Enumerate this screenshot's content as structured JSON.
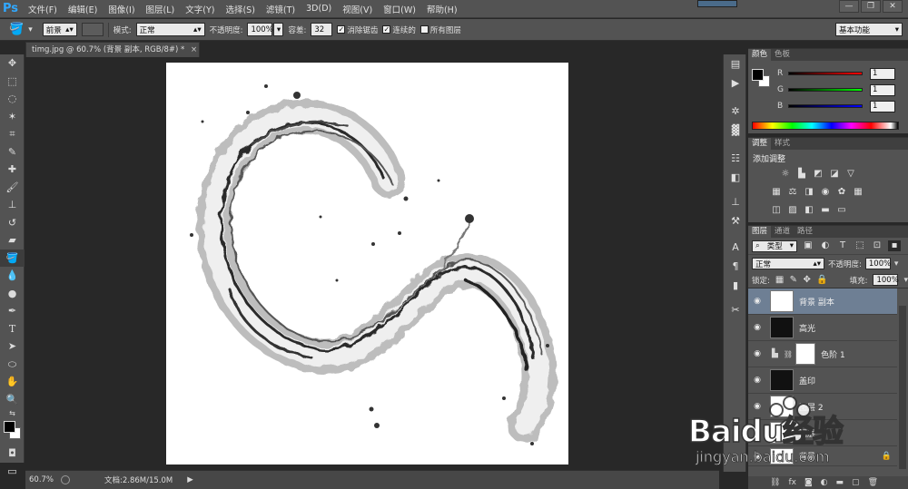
{
  "app": {
    "logo": "Ps"
  },
  "menu": [
    "文件(F)",
    "编辑(E)",
    "图像(I)",
    "图层(L)",
    "文字(Y)",
    "选择(S)",
    "滤镜(T)",
    "3D(D)",
    "视图(V)",
    "窗口(W)",
    "帮助(H)"
  ],
  "window_controls": {
    "minimize": "—",
    "restore": "❐",
    "close": "✕"
  },
  "options": {
    "fill_source": "前景",
    "mode_label": "模式:",
    "mode_value": "正常",
    "opacity_label": "不透明度:",
    "opacity_value": "100%",
    "tolerance_label": "容差:",
    "tolerance_value": "32",
    "antialias_label": "消除锯齿",
    "contiguous_label": "连续的",
    "all_layers_label": "所有图层",
    "workspace": "基本功能"
  },
  "document": {
    "tab_title": "timg.jpg @ 60.7% (背景 副本, RGB/8#) *",
    "zoom": "60.7%",
    "doc_size": "文档:2.86M/15.0M"
  },
  "color_panel": {
    "tabs": [
      "颜色",
      "色板"
    ],
    "r_label": "R",
    "g_label": "G",
    "b_label": "B",
    "r_value": "1",
    "g_value": "1",
    "b_value": "1"
  },
  "adjust_panel": {
    "tabs": [
      "调整",
      "样式"
    ],
    "heading": "添加调整"
  },
  "layers_panel": {
    "tabs": [
      "图层",
      "通道",
      "路径"
    ],
    "filter_kind": "类型",
    "blend_mode": "正常",
    "opacity_label": "不透明度:",
    "opacity_value": "100%",
    "lock_label": "锁定:",
    "fill_label": "填充:",
    "fill_value": "100%",
    "layers": [
      {
        "name": "背景 副本",
        "selected": true
      },
      {
        "name": "高光",
        "selected": false
      },
      {
        "name": "色阶 1",
        "selected": false
      },
      {
        "name": "盖印",
        "selected": false
      },
      {
        "name": "图层 2",
        "selected": false
      },
      {
        "name": "图层",
        "selected": false
      },
      {
        "name": "背景",
        "selected": false
      }
    ]
  },
  "watermark": {
    "brand": "Baidu经验",
    "url": "jingyan.baidu.com"
  },
  "colors": {
    "accent_selected_layer": "#6e7f94",
    "ps_blue": "#31a8ff"
  }
}
